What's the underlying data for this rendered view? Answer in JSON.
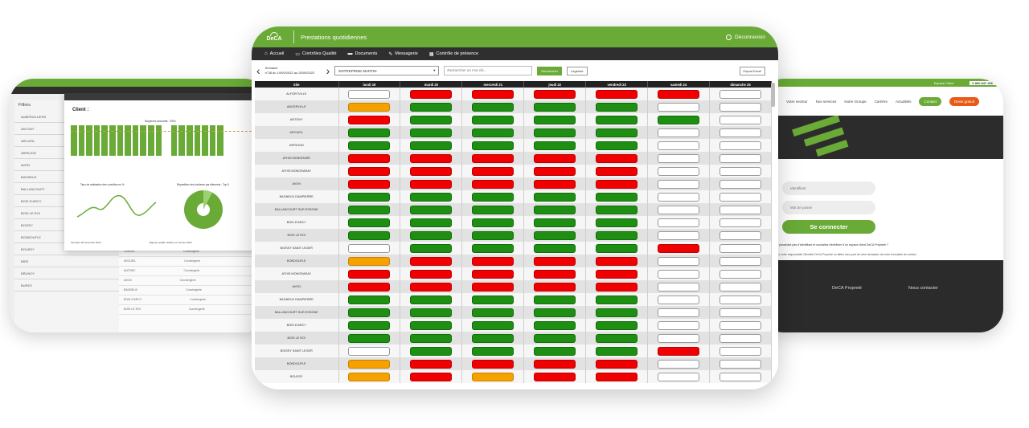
{
  "left": {
    "filters_label": "Filtres",
    "report_title": "Client :",
    "bar_title": "Moyenne annuelle : 93%",
    "line_caption": "Taux de réalisation des contrôles en %",
    "pie_caption": "Répartition des incidents par éléments - Top 5",
    "footer_left": "Semaine 38 novembre 2022",
    "footer_right": "Rapport qualité réalisé sur l'année 2022",
    "filter_rows": [
      "AUBERVILLIERS",
      "ANTONY",
      "ARCUEIL",
      "ARPAJON",
      "AVON",
      "BAGNEUX",
      "BALLANCOURT",
      "BOIS D'ARCY",
      "BOIS LE ROI",
      "BOISSY",
      "BONDOUFLE",
      "BOUSSY",
      "BRIE",
      "BRUNOY",
      "BURES"
    ],
    "table_rows": [
      {
        "a": "CARBEL",
        "b": "Conciergerie"
      },
      {
        "a": "ARCUEIL",
        "b": "Conciergerie"
      },
      {
        "a": "ANTONY",
        "b": "Conciergerie"
      },
      {
        "a": "AVON",
        "b": "Conciergerie"
      },
      {
        "a": "BAGNEUX",
        "b": "Conciergerie"
      },
      {
        "a": "BOIS D'ARCY",
        "b": "Conciergerie"
      },
      {
        "a": "BOIS LE ROI",
        "b": "Conciergerie"
      }
    ]
  },
  "right": {
    "top_link": "Espace Client",
    "phone": "0 800 847 266",
    "nav": [
      "Votre secteur",
      "Nos services",
      "Notre Groupe",
      "Carrière",
      "Actualités"
    ],
    "contact_btn": "Contact",
    "devis_btn": "Devis gratuit",
    "login_placeholder": "Identifiant",
    "password_placeholder": "Mot de passe",
    "connect_btn": "Se connecter",
    "question": "Vous ne possédez pas d'identifiant et souhaitez bénéficier d'un espace client DeCA Propreté ?",
    "answer": "Contactez votre responsable Clientèle DeCA Propreté ou faites nous part de votre demande via notre formulaire de contact",
    "footer_left": "DeCA Propreté",
    "footer_right": "Nous contacter"
  },
  "main": {
    "logo": "DeCA",
    "title": "Prestations quotidiennes",
    "logout": "Déconnexion",
    "nav": [
      {
        "icon": "home-icon",
        "glyph": "⌂",
        "label": "Accueil"
      },
      {
        "icon": "monitor-icon",
        "glyph": "▭",
        "label": "Contrôles Qualité"
      },
      {
        "icon": "folder-icon",
        "glyph": "▬",
        "label": "Documents"
      },
      {
        "icon": "pen-icon",
        "glyph": "✎",
        "label": "Messagerie"
      },
      {
        "icon": "calendar-icon",
        "glyph": "▦",
        "label": "Contrôle de présence"
      }
    ],
    "week_label": "Semaine",
    "week_range": "n°38 du 19/09/2022 au 25/09/2022",
    "client_select": "ENTREPRISE MARTIN",
    "search_placeholder": "Rechercher un mot clé...",
    "search_btn": "Rechercher",
    "legend_btn": "Légende",
    "export_btn": "Export Excel",
    "columns": [
      "Site",
      "lundi 19",
      "mardi 20",
      "mercredi 21",
      "jeudi 22",
      "vendredi 23",
      "samedi 24",
      "dimanche 25"
    ],
    "colors": {
      "red": "#f00000",
      "green": "#1e8f12",
      "orange": "#f5a100",
      "white": "#ffffff"
    },
    "rows": [
      {
        "site": "ALFORTVILLE",
        "cells": [
          "w",
          "r",
          "r",
          "r",
          "r",
          "r",
          "w"
        ]
      },
      {
        "site": "ANGERVILLE",
        "cells": [
          "o",
          "g",
          "g",
          "g",
          "g",
          "w",
          "w"
        ]
      },
      {
        "site": "ANTONY",
        "cells": [
          "r",
          "g",
          "g",
          "g",
          "g",
          "g",
          "w"
        ]
      },
      {
        "site": "ARCUEIL",
        "cells": [
          "g",
          "g",
          "g",
          "g",
          "g",
          "w",
          "w"
        ]
      },
      {
        "site": "ARPAJON",
        "cells": [
          "g",
          "g",
          "g",
          "g",
          "g",
          "w",
          "w"
        ]
      },
      {
        "site": "ATHIS MONGRARÉ",
        "cells": [
          "r",
          "r",
          "r",
          "r",
          "r",
          "w",
          "w"
        ]
      },
      {
        "site": "ATHIS MONGRARAY",
        "cells": [
          "r",
          "r",
          "r",
          "r",
          "r",
          "w",
          "w"
        ]
      },
      {
        "site": "AVON",
        "cells": [
          "r",
          "r",
          "r",
          "r",
          "r",
          "w",
          "w"
        ]
      },
      {
        "site": "BAGNEUX DAMPIERRE",
        "cells": [
          "g",
          "g",
          "g",
          "g",
          "g",
          "w",
          "w"
        ]
      },
      {
        "site": "BALLANCOURT SUR ESSONE",
        "cells": [
          "g",
          "g",
          "g",
          "g",
          "g",
          "w",
          "w"
        ]
      },
      {
        "site": "BOIS D'ARCY",
        "cells": [
          "g",
          "g",
          "g",
          "g",
          "g",
          "w",
          "w"
        ]
      },
      {
        "site": "BOIS LE ROI",
        "cells": [
          "g",
          "g",
          "g",
          "g",
          "g",
          "w",
          "w"
        ]
      },
      {
        "site": "BOISSY SAINT LEGER",
        "cells": [
          "w",
          "g",
          "g",
          "g",
          "g",
          "r",
          "w"
        ]
      },
      {
        "site": "BONDOUFLE",
        "cells": [
          "o",
          "r",
          "r",
          "r",
          "r",
          "w",
          "w"
        ]
      },
      {
        "site": "ATHIS MONGRARAY",
        "cells": [
          "r",
          "r",
          "r",
          "r",
          "r",
          "w",
          "w"
        ]
      },
      {
        "site": "AVON",
        "cells": [
          "r",
          "r",
          "r",
          "r",
          "r",
          "w",
          "w"
        ]
      },
      {
        "site": "BAGNEUX DAMPIERRE",
        "cells": [
          "g",
          "g",
          "g",
          "g",
          "g",
          "w",
          "w"
        ]
      },
      {
        "site": "BALLANCOURT SUR ESSONE",
        "cells": [
          "g",
          "g",
          "g",
          "g",
          "g",
          "w",
          "w"
        ]
      },
      {
        "site": "BOIS D'ARCY",
        "cells": [
          "g",
          "g",
          "g",
          "g",
          "g",
          "w",
          "w"
        ]
      },
      {
        "site": "BOIS LE ROI",
        "cells": [
          "g",
          "g",
          "g",
          "g",
          "g",
          "w",
          "w"
        ]
      },
      {
        "site": "BOISSY SAINT LEGER",
        "cells": [
          "w",
          "g",
          "g",
          "g",
          "g",
          "r",
          "w"
        ]
      },
      {
        "site": "BONDOUFLE",
        "cells": [
          "o",
          "r",
          "r",
          "r",
          "r",
          "w",
          "w"
        ]
      },
      {
        "site": "BOUSSY",
        "cells": [
          "o",
          "r",
          "o",
          "r",
          "r",
          "w",
          "w"
        ]
      }
    ]
  }
}
